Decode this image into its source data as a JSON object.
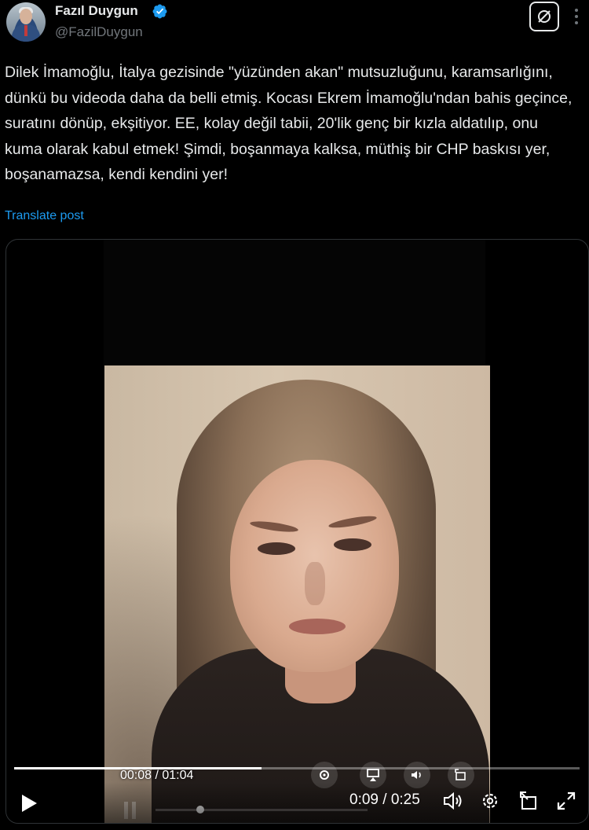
{
  "author": {
    "name": "Fazıl Duygun",
    "handle": "@FazilDuygun",
    "verified_badge_icon": "verified-badge-icon"
  },
  "post": {
    "text": "Dilek İmamoğlu, İtalya gezisinde \"yüzünden akan\" mutsuzluğunu, karamsarlığını, dünkü bu videoda daha da belli etmiş. Kocası Ekrem İmamoğlu'ndan bahis geçince, suratını dönüp, ekşitiyor. EE, kolay değil tabii, 20'lik genç bir kızla aldatılıp, onu kuma olarak kabul etmek! Şimdi, boşanmaya kalksa, müthiş bir CHP baskısı yer, boşanamazsa, kendi kendini yer!",
    "translate_label": "Translate post"
  },
  "video": {
    "embedded_time": "00:08 / 01:04",
    "embedded_progress": 0.125,
    "player_time": "0:09 / 0:25",
    "icons": [
      "play-icon",
      "volume-icon",
      "settings-icon",
      "picture-in-picture-icon",
      "fullscreen-icon"
    ]
  },
  "colors": {
    "background": "#000000",
    "text": "#e7e9ea",
    "muted": "#71767b",
    "link": "#1d9bf0"
  }
}
